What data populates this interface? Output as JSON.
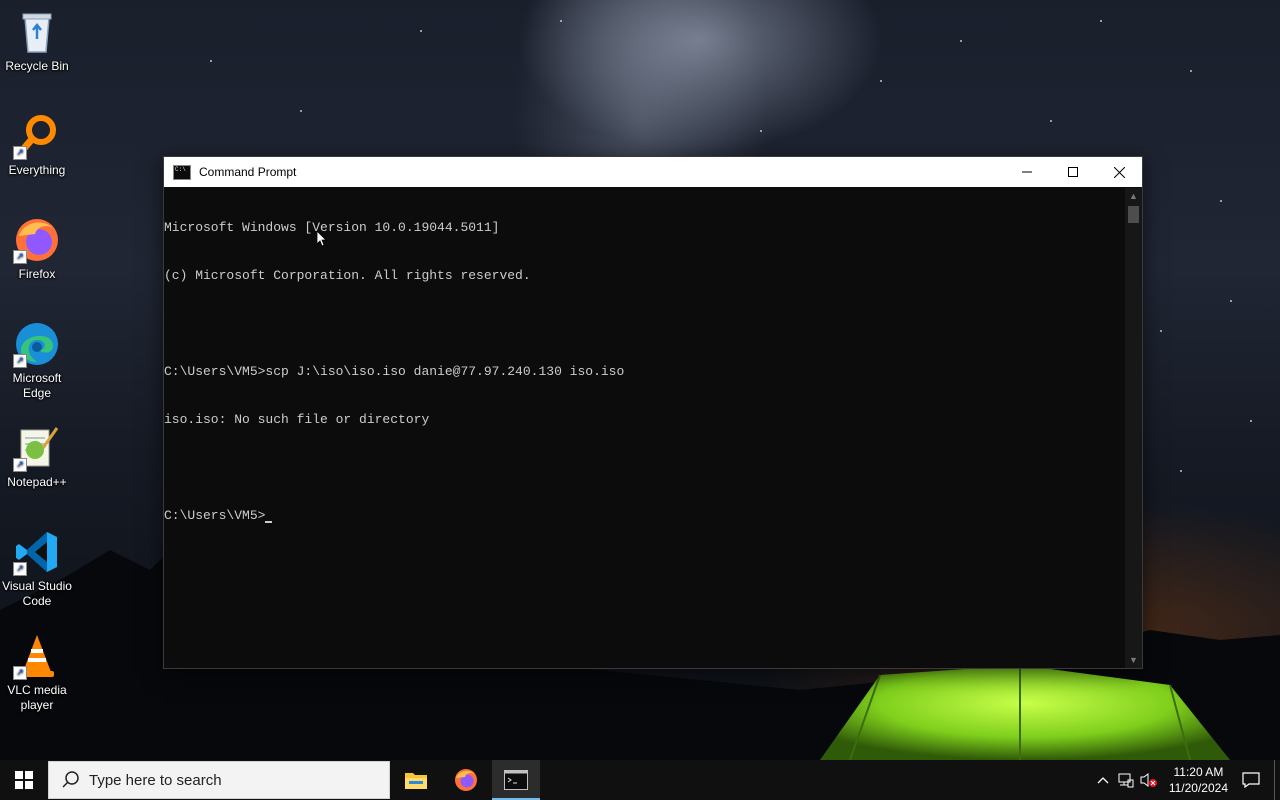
{
  "desktop": {
    "icons": [
      {
        "label": "Recycle Bin",
        "icon": "recycle-bin-icon"
      },
      {
        "label": "Everything",
        "icon": "everything-search-icon"
      },
      {
        "label": "Firefox",
        "icon": "firefox-icon"
      },
      {
        "label": "Microsoft Edge",
        "icon": "edge-icon"
      },
      {
        "label": "Notepad++",
        "icon": "notepadpp-icon"
      },
      {
        "label": "Visual Studio Code",
        "icon": "vscode-icon"
      },
      {
        "label": "VLC media player",
        "icon": "vlc-icon"
      }
    ]
  },
  "window": {
    "title": "Command Prompt",
    "minimize": "—",
    "maximize": "☐",
    "close": "✕",
    "lines": [
      "Microsoft Windows [Version 10.0.19044.5011]",
      "(c) Microsoft Corporation. All rights reserved.",
      "",
      "C:\\Users\\VM5>scp J:\\iso\\iso.iso danie@77.97.240.130 iso.iso",
      "iso.iso: No such file or directory",
      "",
      "C:\\Users\\VM5>"
    ],
    "colors": {
      "background": "#0c0c0c",
      "text": "#cccccc"
    }
  },
  "taskbar": {
    "search_placeholder": "Type here to search",
    "apps": [
      {
        "name": "File Explorer",
        "icon": "file-explorer-icon",
        "active": false
      },
      {
        "name": "Firefox",
        "icon": "firefox-icon",
        "active": false
      },
      {
        "name": "Command Prompt",
        "icon": "command-prompt-icon",
        "active": true
      }
    ],
    "clock": {
      "time": "11:20 AM",
      "date": "11/20/2024"
    },
    "accent": "#76b9ed"
  }
}
